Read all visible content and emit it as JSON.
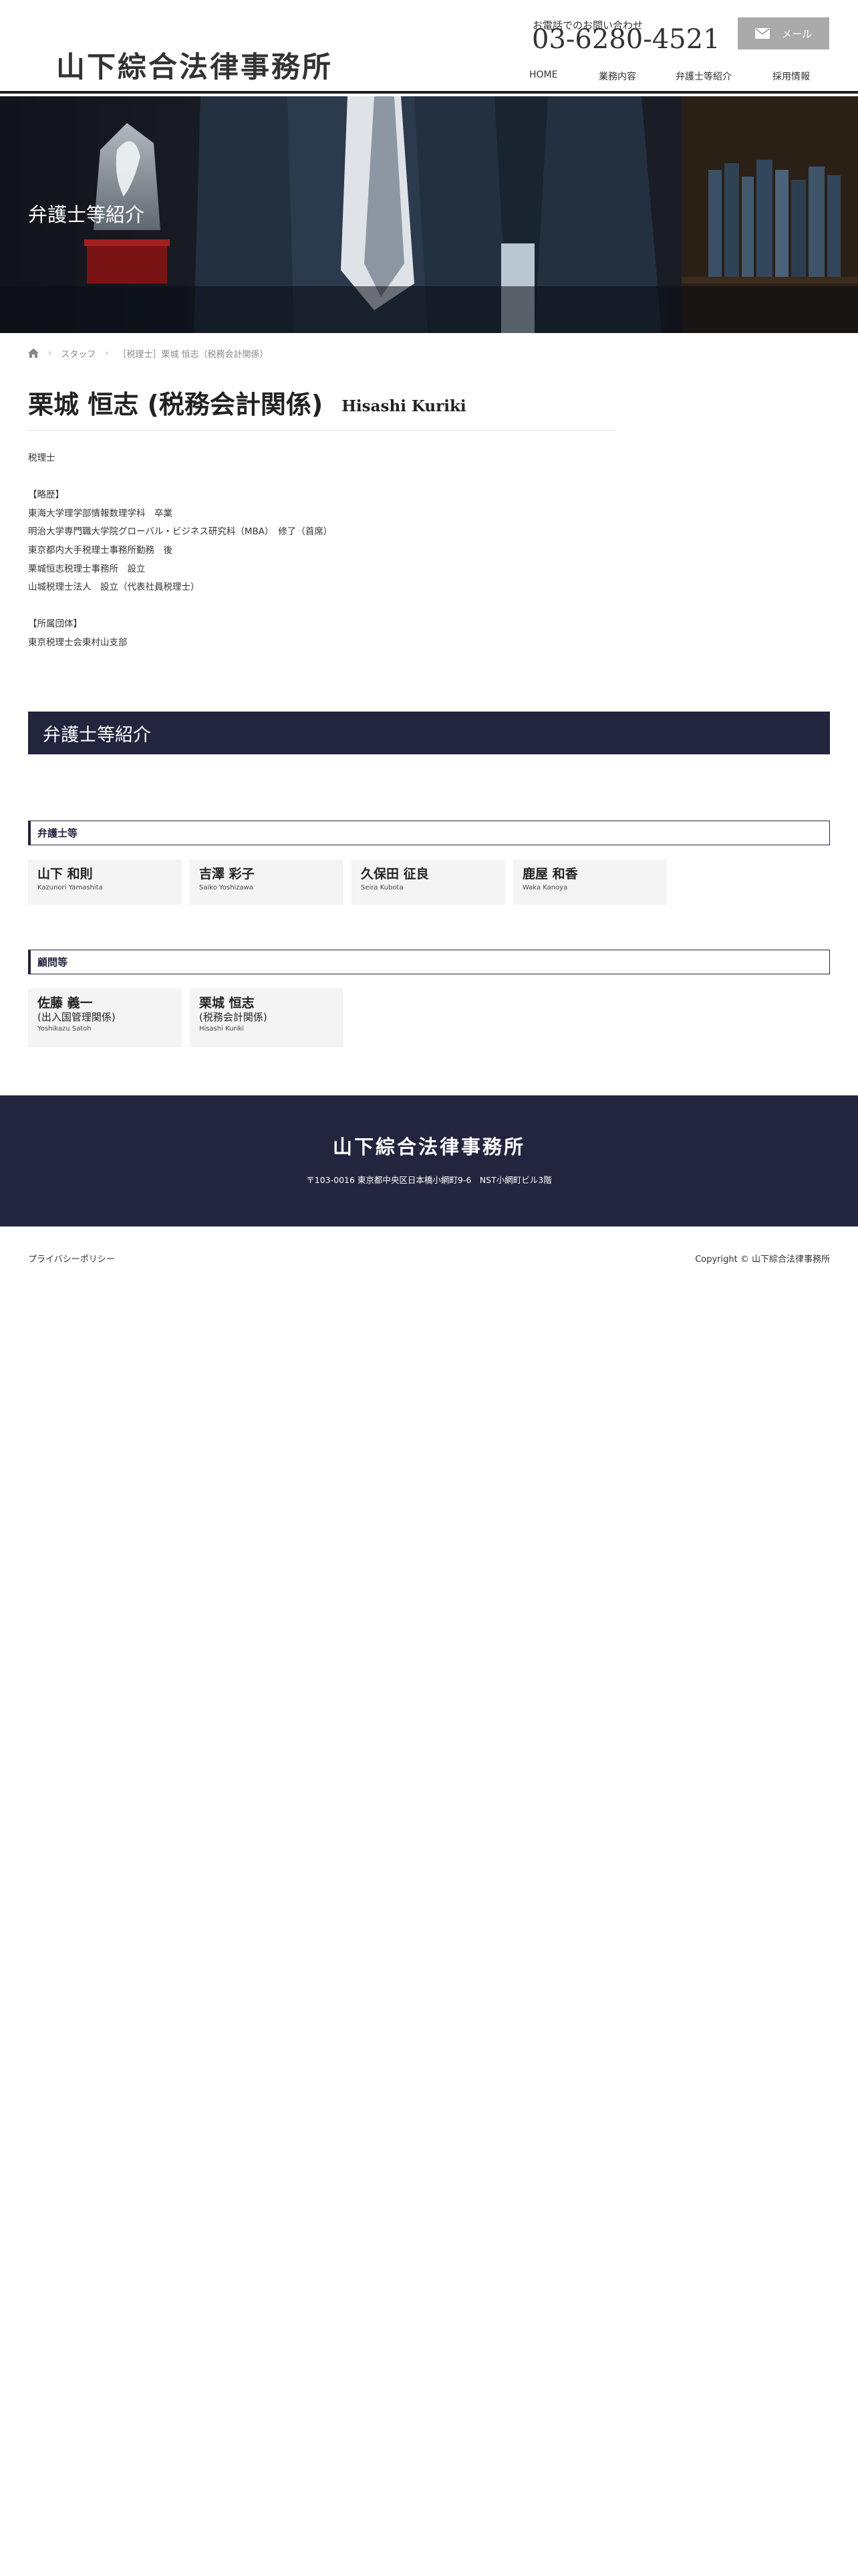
{
  "header": {
    "logo": "山下綜合法律事務所",
    "phone_label": "お電話でのお問い合わせ",
    "phone": "03-6280-4521",
    "mail_label": "メール"
  },
  "nav": [
    "HOME",
    "業務内容",
    "弁護士等紹介",
    "採用情報"
  ],
  "hero": {
    "title": "弁護士等紹介"
  },
  "breadcrumb": {
    "staff": "スタッフ",
    "current": "［税理士］栗城 恒志（税務会計関係）"
  },
  "profile": {
    "name": "栗城 恒志 (税務会計関係)",
    "romaji": "Hisashi Kuriki",
    "bio": [
      "税理士",
      "",
      "【略歴】",
      "東海大学理学部情報数理学科　卒業",
      "明治大学専門職大学院グローバル・ビジネス研究科（MBA）　修了（首席）",
      "東京都内大手税理士事務所勤務　後",
      "栗城恒志税理士事務所　設立",
      "山城税理士法人　設立（代表社員税理士）",
      "",
      "【所属団体】",
      "東京税理士会東村山支部"
    ]
  },
  "section": {
    "title": "弁護士等紹介",
    "groups": [
      {
        "heading": "弁護士等",
        "members": [
          {
            "name": "山下 和則",
            "role": "",
            "romaji": "Kazunori Yamashita"
          },
          {
            "name": "吉澤 彩子",
            "role": "",
            "romaji": "Saiko Yoshizawa"
          },
          {
            "name": "久保田 征良",
            "role": "",
            "romaji": "Seira Kubota"
          },
          {
            "name": "鹿屋 和香",
            "role": "",
            "romaji": "Waka Kanoya"
          }
        ]
      },
      {
        "heading": "顧問等",
        "members": [
          {
            "name": "佐藤 義一",
            "role": "(出入国管理関係)",
            "romaji": "Yoshikazu Satoh"
          },
          {
            "name": "栗城 恒志",
            "role": "(税務会計関係)",
            "romaji": "Hisashi Kuriki"
          }
        ]
      }
    ]
  },
  "footer": {
    "logo": "山下綜合法律事務所",
    "address": "〒103-0016 東京都中央区日本橋小網町9-6　NST小網町ビル3階",
    "privacy": "プライバシーポリシー",
    "copyright": "Copyright ©  山下綜合法律事務所"
  },
  "colors": {
    "navy": "#23243d",
    "mail_button": "#aaaaaa"
  }
}
